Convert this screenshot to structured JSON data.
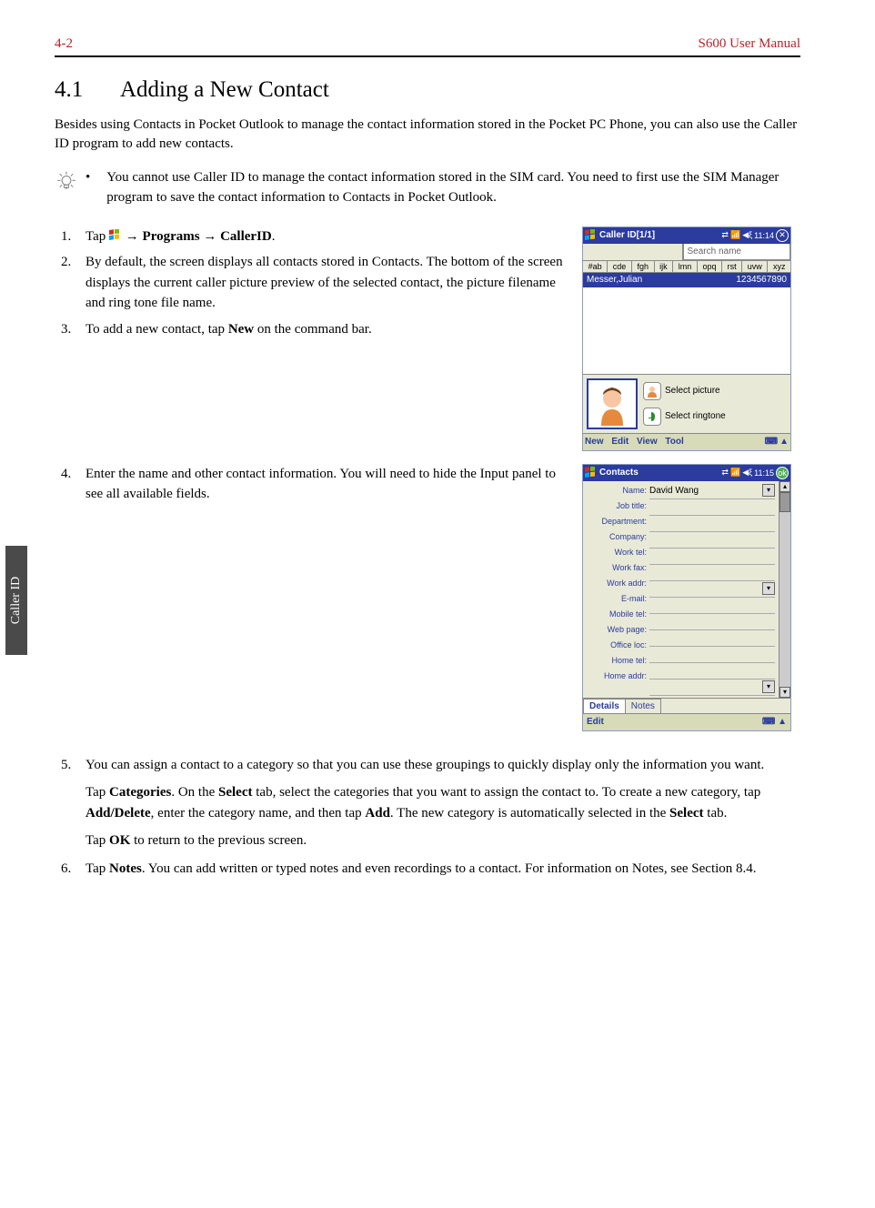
{
  "header": {
    "page_num": "4-2",
    "manual_title": "S600 User Manual"
  },
  "section": {
    "number": "4.1",
    "title": "Adding a New Contact"
  },
  "side_tab": "Caller ID",
  "intro": "Besides using Contacts in Pocket Outlook to manage the contact information stored in the Pocket PC Phone, you can also use the Caller ID program to add new contacts.",
  "note": "You cannot use Caller ID to manage the contact information stored in the SIM card. You need to first use the SIM Manager program to save the contact information to Contacts in Pocket Outlook.",
  "steps": {
    "s1_pre": "Tap ",
    "s1_nav1": "Programs",
    "s1_nav2": "CallerID",
    "s1_arrow": "→",
    "s2": "By default, the screen displays all contacts stored in Contacts. The bottom of the screen displays the current caller picture preview of the selected contact, the picture filename and ring tone file name.",
    "s3_pre": "To add a new contact, tap ",
    "s3_bold": "New",
    "s3_post": " on the command bar.",
    "s4": "Enter the name and other contact information. You will need to hide the Input panel to see all available fields.",
    "s5_a": "You can assign a contact to a category so that you can use these groupings to quickly display only the information you want.",
    "s5_b_pre": "Tap ",
    "s5_b_cat": "Categories",
    "s5_b_mid1": ". On the ",
    "s5_b_sel": "Select",
    "s5_b_mid2": " tab, select the categories that you want to assign the contact to. To create a new category, tap ",
    "s5_b_add": "Add/Delete",
    "s5_b_mid3": ", enter the category name, and then tap ",
    "s5_b_addbtn": "Add",
    "s5_b_mid4": ". The new category is automatically selected in the ",
    "s5_b_sel2": "Select",
    "s5_b_end": " tab.",
    "s5_c_pre": "Tap ",
    "s5_c_ok": "OK",
    "s5_c_post": " to return to the previous screen.",
    "s6_pre": "Tap ",
    "s6_notes": "Notes",
    "s6_post": ". You can add written or typed notes and even recordings to a contact. For information on Notes, see Section 8.4."
  },
  "shot1": {
    "title": "Caller ID[1/1]",
    "time": "11:14",
    "search_placeholder": "Search name",
    "abc": [
      "#ab",
      "cde",
      "fgh",
      "ijk",
      "lmn",
      "opq",
      "rst",
      "uvw",
      "xyz"
    ],
    "contact_name": "Messer,Julian",
    "contact_num": "1234567890",
    "sel_picture": "Select picture",
    "sel_ringtone": "Select ringtone",
    "cmd": [
      "New",
      "Edit",
      "View",
      "Tool"
    ]
  },
  "shot2": {
    "title": "Contacts",
    "time": "11:15",
    "ok": "ok",
    "labels": [
      "Name:",
      "Job title:",
      "Department:",
      "Company:",
      "Work tel:",
      "Work fax:",
      "Work addr:",
      "E-mail:",
      "Mobile tel:",
      "Web page:",
      "Office loc:",
      "Home tel:",
      "Home addr:"
    ],
    "name_value": "David Wang",
    "tabs": [
      "Details",
      "Notes"
    ],
    "edit": "Edit"
  }
}
